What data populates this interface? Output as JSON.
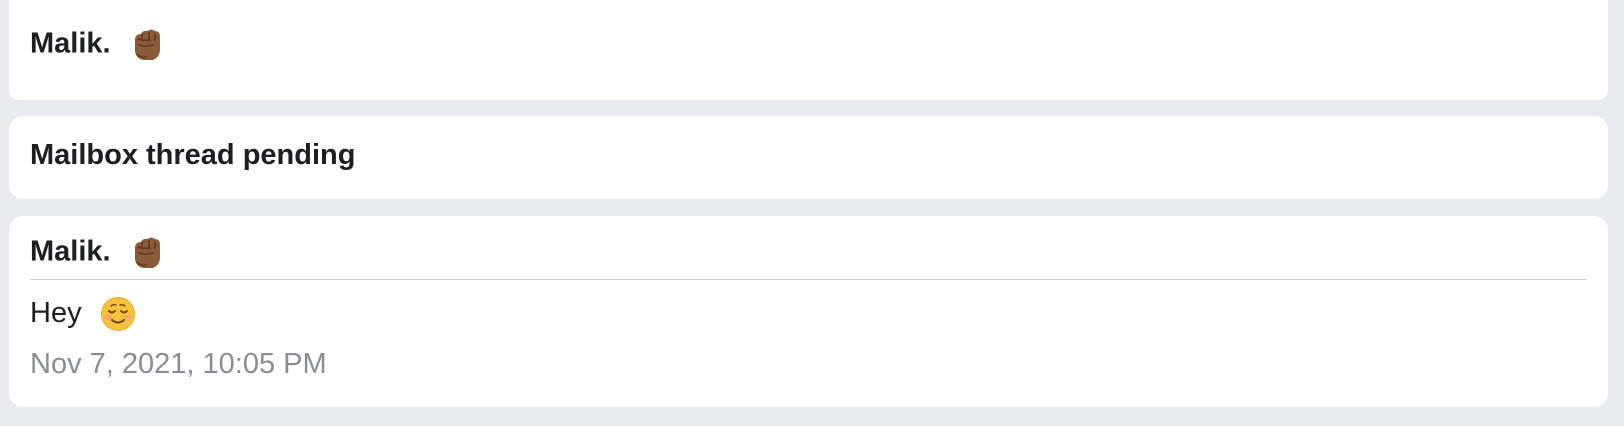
{
  "cards": [
    {
      "sender": "Malik.",
      "sender_emoji": "raised-fist-medium-dark-skin-tone"
    },
    {
      "title": "Mailbox thread pending"
    },
    {
      "sender": "Malik.",
      "sender_emoji": "raised-fist-medium-dark-skin-tone",
      "message": "Hey",
      "message_emoji": "smiling-face",
      "timestamp": "Nov 7, 2021, 10:05 PM"
    }
  ],
  "colors": {
    "page_background": "#e9eaed",
    "card_background": "#ffffff",
    "text_primary": "#1c1e21",
    "text_secondary": "#8a8d91",
    "divider": "#cfd1d5"
  }
}
